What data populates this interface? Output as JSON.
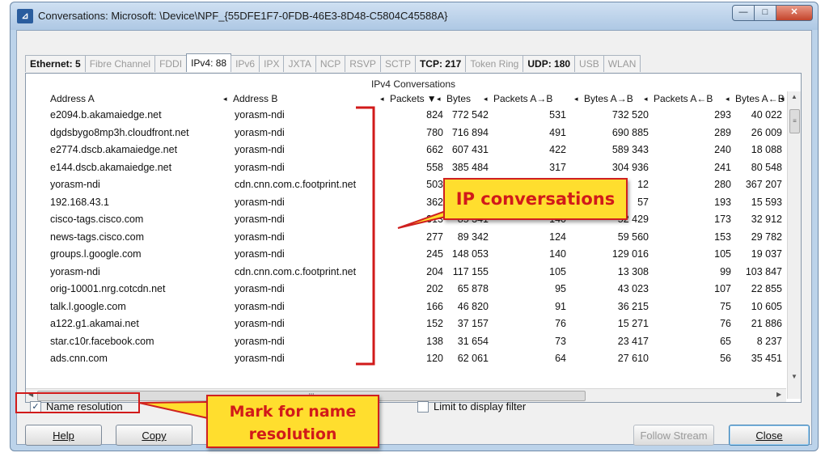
{
  "window": {
    "title": "Conversations: Microsoft: \\Device\\NPF_{55DFE1F7-0FDB-46E3-8D48-C5804C45588A}",
    "app_icon": "wireshark-icon",
    "controls": [
      "minimize",
      "maximize",
      "close"
    ]
  },
  "tabs": [
    {
      "label": "Ethernet: 5",
      "state": "bold"
    },
    {
      "label": "Fibre Channel",
      "state": "disabled"
    },
    {
      "label": "FDDI",
      "state": "disabled"
    },
    {
      "label": "IPv4: 88",
      "state": "active"
    },
    {
      "label": "IPv6",
      "state": "disabled"
    },
    {
      "label": "IPX",
      "state": "disabled"
    },
    {
      "label": "JXTA",
      "state": "disabled"
    },
    {
      "label": "NCP",
      "state": "disabled"
    },
    {
      "label": "RSVP",
      "state": "disabled"
    },
    {
      "label": "SCTP",
      "state": "disabled"
    },
    {
      "label": "TCP: 217",
      "state": "bold"
    },
    {
      "label": "Token Ring",
      "state": "disabled"
    },
    {
      "label": "UDP: 180",
      "state": "bold"
    },
    {
      "label": "USB",
      "state": "disabled"
    },
    {
      "label": "WLAN",
      "state": "disabled"
    }
  ],
  "table": {
    "caption": "IPv4 Conversations",
    "headers": [
      "Address A",
      "Address B",
      "Packets",
      "Bytes",
      "Packets A→B",
      "Bytes A→B",
      "Packets A←B",
      "Bytes A←B"
    ],
    "sort_marker": "▼",
    "resize_marker": "◂",
    "rows": [
      [
        "e2094.b.akamaiedge.net",
        "yorasm-ndi",
        "824",
        "772 542",
        "531",
        "732 520",
        "293",
        "40 022"
      ],
      [
        "dgdsbygo8mp3h.cloudfront.net",
        "yorasm-ndi",
        "780",
        "716 894",
        "491",
        "690 885",
        "289",
        "26 009"
      ],
      [
        "e2774.dscb.akamaiedge.net",
        "yorasm-ndi",
        "662",
        "607 431",
        "422",
        "589 343",
        "240",
        "18 088"
      ],
      [
        "e144.dscb.akamaiedge.net",
        "yorasm-ndi",
        "558",
        "385 484",
        "317",
        "304 936",
        "241",
        "80 548"
      ],
      [
        "yorasm-ndi",
        "cdn.cnn.com.c.footprint.net",
        "503",
        "38",
        "",
        "12",
        "280",
        "367 207"
      ],
      [
        "192.168.43.1",
        "yorasm-ndi",
        "362",
        "",
        "",
        "57",
        "193",
        "15 593"
      ],
      [
        "cisco-tags.cisco.com",
        "yorasm-ndi",
        "313",
        "85 341",
        "140",
        "52 429",
        "173",
        "32 912"
      ],
      [
        "news-tags.cisco.com",
        "yorasm-ndi",
        "277",
        "89 342",
        "124",
        "59 560",
        "153",
        "29 782"
      ],
      [
        "groups.l.google.com",
        "yorasm-ndi",
        "245",
        "148 053",
        "140",
        "129 016",
        "105",
        "19 037"
      ],
      [
        "yorasm-ndi",
        "cdn.cnn.com.c.footprint.net",
        "204",
        "117 155",
        "105",
        "13 308",
        "99",
        "103 847"
      ],
      [
        "orig-10001.nrg.cotcdn.net",
        "yorasm-ndi",
        "202",
        "65 878",
        "95",
        "43 023",
        "107",
        "22 855"
      ],
      [
        "talk.l.google.com",
        "yorasm-ndi",
        "166",
        "46 820",
        "91",
        "36 215",
        "75",
        "10 605"
      ],
      [
        "a122.g1.akamai.net",
        "yorasm-ndi",
        "152",
        "37 157",
        "76",
        "15 271",
        "76",
        "21 886"
      ],
      [
        "star.c10r.facebook.com",
        "yorasm-ndi",
        "138",
        "31 654",
        "73",
        "23 417",
        "65",
        "8 237"
      ],
      [
        "ads.cnn.com",
        "yorasm-ndi",
        "120",
        "62 061",
        "64",
        "27 610",
        "56",
        "35 451"
      ]
    ]
  },
  "scroll": {
    "h_thumb_grip": "III"
  },
  "options": {
    "name_resolution": {
      "label": "Name resolution",
      "checked": true
    },
    "limit_filter": {
      "label": "Limit to display filter",
      "checked": false
    }
  },
  "buttons": {
    "help": "Help",
    "copy": "Copy",
    "follow_stream": "Follow Stream",
    "close": "Close"
  },
  "annotations": {
    "ip_callout": "IP conversations",
    "name_callout_line1": "Mark for name",
    "name_callout_line2": "resolution",
    "annotation_color": "#d11a1a",
    "callout_fill": "#ffde2e"
  }
}
